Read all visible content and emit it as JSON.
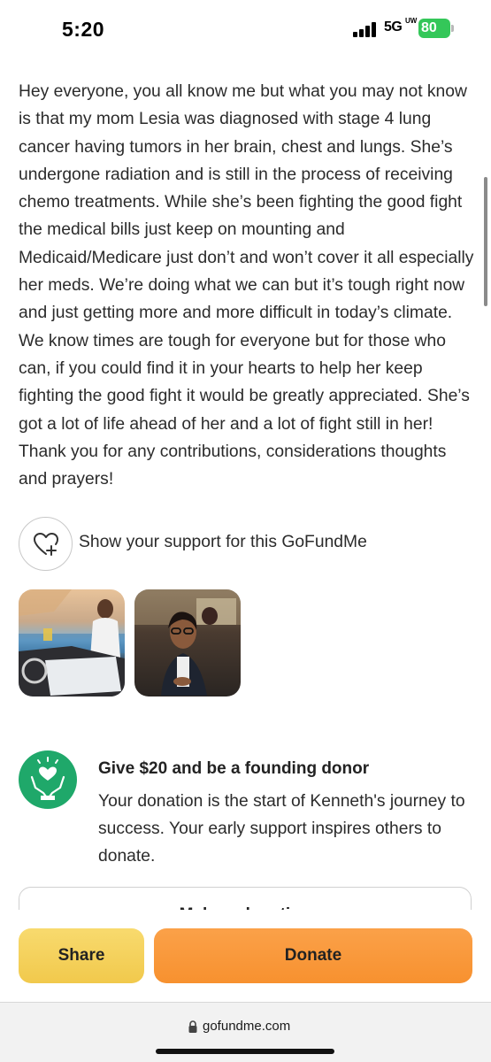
{
  "status_bar": {
    "time": "5:20",
    "network": "5G",
    "network_sup": "UW",
    "battery": "80"
  },
  "story": {
    "text": "Hey everyone, you all know me but what you may not know is that my mom Lesia was diagnosed with stage 4 lung cancer having tumors in her brain, chest and lungs. She’s undergone radiation and is still in the process of receiving chemo treatments. While she’s been fighting the good fight the medical bills just keep on mounting and Medicaid/Medicare just don’t and won’t cover it all especially her meds. We’re doing what we can but it’s tough right now and just getting more and more difficult in today’s climate. We know times are tough for everyone but for those who can, if you could find it in your hearts to help her keep fighting the good fight it would be greatly appreciated. She’s got a lot of life ahead of her and a lot of fight still in her! Thank you for any contributions, considerations thoughts and prayers!"
  },
  "support": {
    "label": "Show your support for this GoFundMe",
    "icon": "heart-plus-icon"
  },
  "photos": [
    {
      "name": "photo-boat"
    },
    {
      "name": "photo-portrait"
    }
  ],
  "founding_donor": {
    "icon": "hands-heart-icon",
    "title": "Give $20 and be a founding donor",
    "description": "Your donation is the start of Kenneth's journey to success. Your early support inspires others to donate.",
    "button_label": "Make a donation"
  },
  "actions": {
    "share_label": "Share",
    "donate_label": "Donate"
  },
  "browser": {
    "url": "gofundme.com"
  },
  "colors": {
    "brand_green": "#1fa86a",
    "share_yellow": "#f1c94c",
    "donate_orange": "#f7912f",
    "battery_green": "#34c759"
  }
}
